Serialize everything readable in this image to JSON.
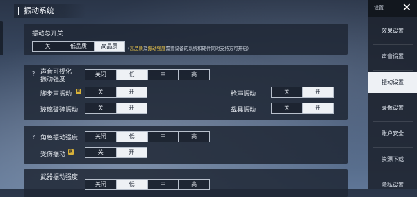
{
  "section_title": "振动系统",
  "sidebar": {
    "top_label": "设置",
    "close_icon": "close-icon",
    "items": [
      {
        "label": "效果设置",
        "active": false
      },
      {
        "label": "声音设置",
        "active": false
      },
      {
        "label": "振动设置",
        "active": true
      },
      {
        "label": "录像设置",
        "active": false
      },
      {
        "label": "账户安全",
        "active": false
      },
      {
        "label": "资源下载",
        "active": false
      },
      {
        "label": "隐私设置",
        "active": false
      }
    ]
  },
  "master": {
    "label": "振动总开关",
    "options": [
      "关",
      "低品质",
      "高品质"
    ],
    "selected": "高品质",
    "note": {
      "hl1": "高品质",
      "mid1": "及",
      "hl2": "振动强度",
      "rest": "需要设备的系统和硬件同时支持方可开启"
    }
  },
  "sound": {
    "help": "?",
    "label_line1": "声音可视化",
    "label_line2": "振动强度",
    "intensity_options": [
      "关闭",
      "低",
      "中",
      "高"
    ],
    "intensity_selected": "低",
    "toggles": [
      {
        "label": "脚步声振动",
        "badge": "R",
        "options": [
          "关",
          "开"
        ],
        "selected": "开"
      },
      {
        "label": "枪声振动",
        "options": [
          "关",
          "开"
        ],
        "selected": "开"
      },
      {
        "label": "玻璃破碎振动",
        "options": [
          "关",
          "开"
        ],
        "selected": "开"
      },
      {
        "label": "载具振动",
        "options": [
          "关",
          "开"
        ],
        "selected": "开"
      }
    ]
  },
  "character": {
    "help": "?",
    "label": "角色振动强度",
    "intensity_options": [
      "关闭",
      "低",
      "中",
      "高"
    ],
    "intensity_selected": "低",
    "hurt": {
      "label": "受伤振动",
      "badge": "R",
      "options": [
        "关",
        "开"
      ],
      "selected": "开"
    }
  },
  "partial": {
    "label": "武器振动强度",
    "intensity_options": [
      "关闭",
      "低",
      "中",
      "高"
    ],
    "intensity_selected": "低"
  }
}
